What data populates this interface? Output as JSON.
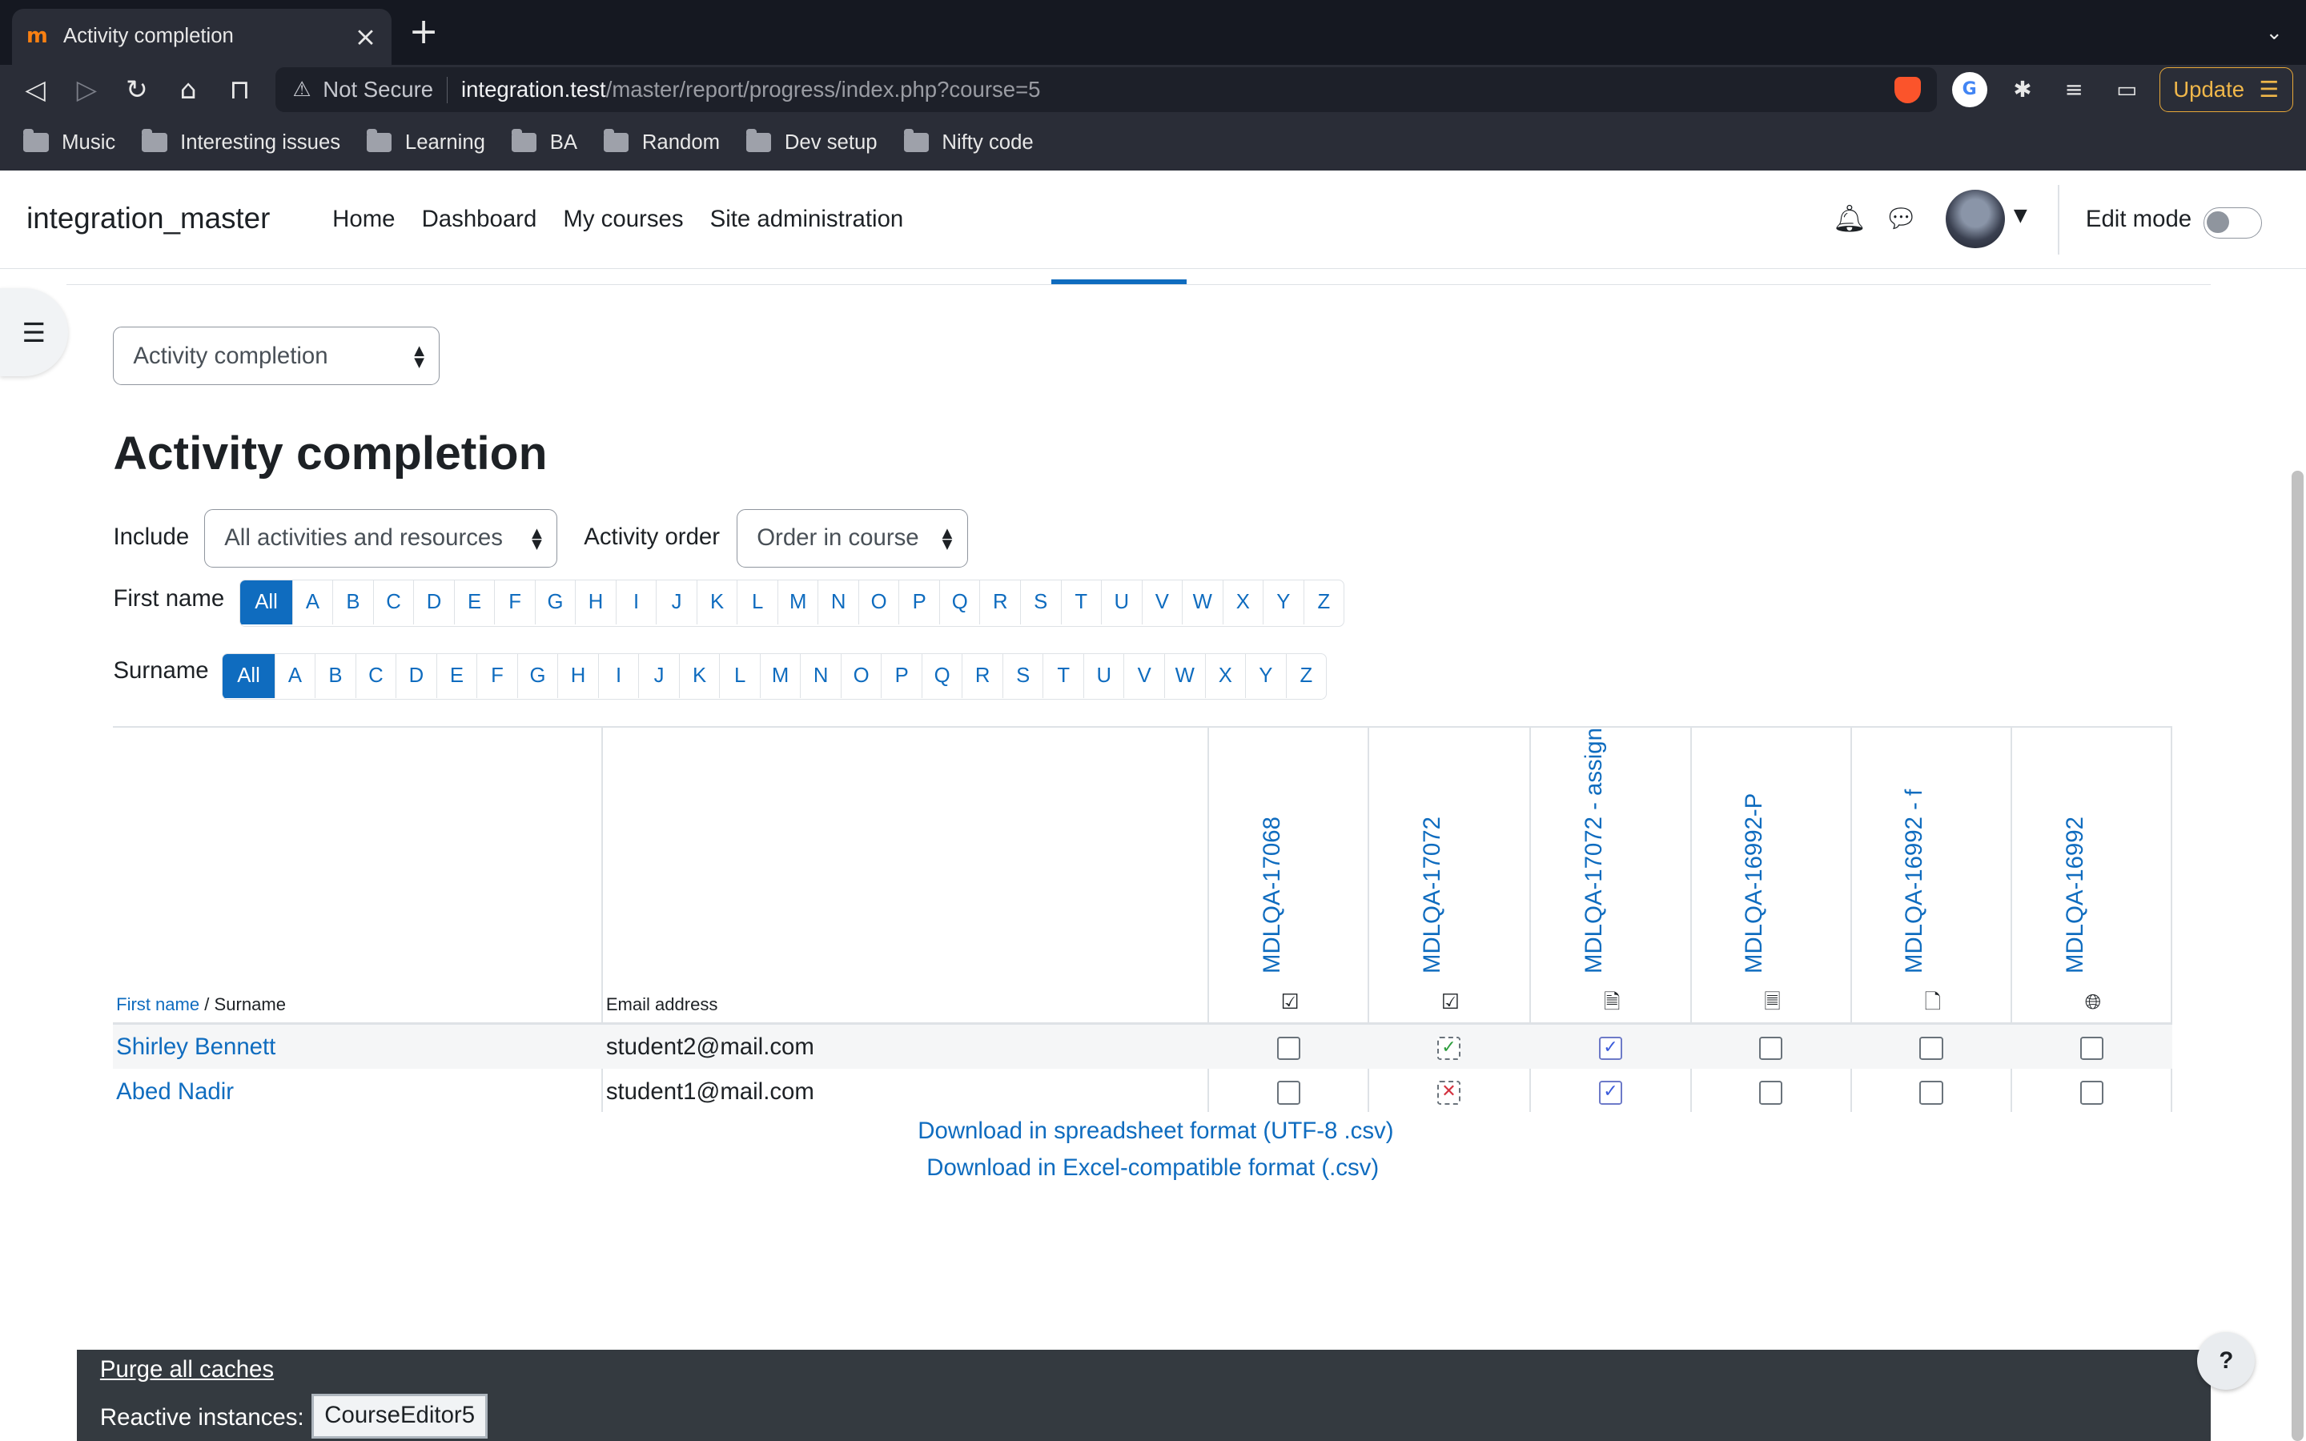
{
  "browser": {
    "tab_title": "Activity completion",
    "url_warning": "Not Secure",
    "url_host": "integration.test",
    "url_path": "/master/report/progress/index.php?course=5",
    "update_label": "Update",
    "bookmarks": [
      "Music",
      "Interesting issues",
      "Learning",
      "BA",
      "Random",
      "Dev setup",
      "Nifty code"
    ]
  },
  "header": {
    "site_name": "integration_master",
    "nav": [
      "Home",
      "Dashboard",
      "My courses",
      "Site administration"
    ],
    "edit_mode_label": "Edit mode"
  },
  "report_selector": {
    "value": "Activity completion"
  },
  "page_title": "Activity completion",
  "filters": {
    "include_label": "Include",
    "include_value": "All activities and resources",
    "order_label": "Activity order",
    "order_value": "Order in course",
    "firstname_label": "First name",
    "surname_label": "Surname",
    "letters": [
      "All",
      "A",
      "B",
      "C",
      "D",
      "E",
      "F",
      "G",
      "H",
      "I",
      "J",
      "K",
      "L",
      "M",
      "N",
      "O",
      "P",
      "Q",
      "R",
      "S",
      "T",
      "U",
      "V",
      "W",
      "X",
      "Y",
      "Z"
    ]
  },
  "table": {
    "header_firstname": "First name",
    "header_sep": " / ",
    "header_surname": "Surname",
    "header_email": "Email address",
    "activities": [
      {
        "name": "MDLQA-17068",
        "icon": "manual-checkbox-icon"
      },
      {
        "name": "MDLQA-17072",
        "icon": "manual-checkbox-icon"
      },
      {
        "name": "MDLQA-17072 - assign",
        "icon": "assignment-icon"
      },
      {
        "name": "MDLQA-16992-P",
        "icon": "page-icon"
      },
      {
        "name": "MDLQA-16992 - f",
        "icon": "file-icon"
      },
      {
        "name": "MDLQA-16992",
        "icon": "url-globe-icon"
      }
    ],
    "rows": [
      {
        "name": "Shirley Bennett",
        "email": "student2@mail.com",
        "states": [
          "empty",
          "pass",
          "manual-done",
          "empty",
          "empty",
          "empty"
        ]
      },
      {
        "name": "Abed Nadir",
        "email": "student1@mail.com",
        "states": [
          "empty",
          "fail",
          "manual-done",
          "empty",
          "empty",
          "empty"
        ]
      }
    ]
  },
  "downloads": {
    "csv_utf8": "Download in spreadsheet format (UTF-8 .csv)",
    "csv_excel": "Download in Excel-compatible format (.csv)"
  },
  "footer": {
    "purge_label": "Purge all caches",
    "reactive_label": "Reactive instances:",
    "reactive_button": "CourseEditor5"
  },
  "help_label": "?"
}
